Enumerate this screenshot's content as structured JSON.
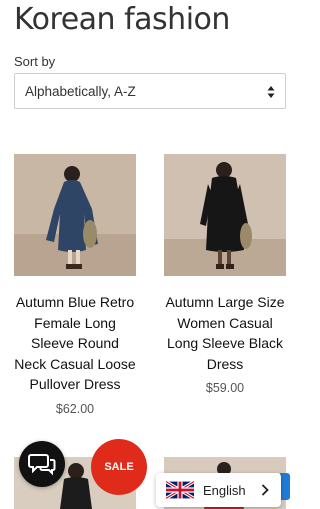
{
  "page": {
    "title": "Korean fashion"
  },
  "sort": {
    "label": "Sort by",
    "selected": "Alphabetically, A-Z"
  },
  "products": [
    {
      "title": "Autumn Blue Retro Female Long Sleeve Round Neck Casual Loose Pullover Dress",
      "price": "$62.00"
    },
    {
      "title": "Autumn Large Size Women Casual Long Sleeve Black Dress",
      "price": "$59.00"
    }
  ],
  "widgets": {
    "sale_label": "SALE",
    "language": "English",
    "chat_icon": "chat-bubbles-icon",
    "flag_icon": "uk-flag-icon"
  },
  "colors": {
    "sale": "#e02b1b",
    "chat": "#111111",
    "accent_blue": "#1f7bd8"
  }
}
